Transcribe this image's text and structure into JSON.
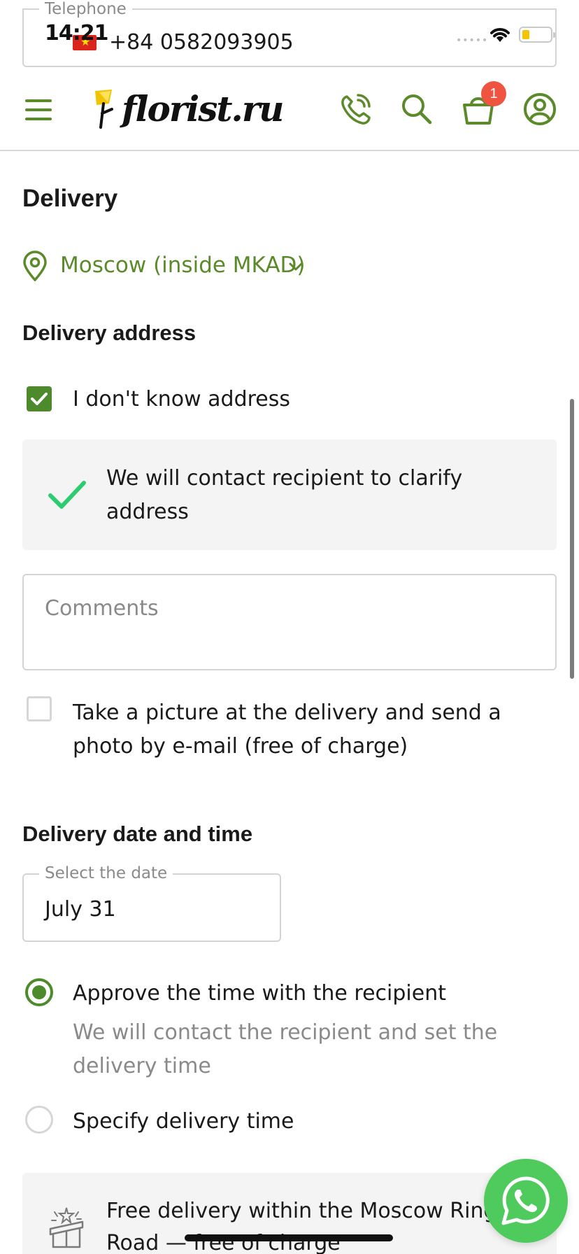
{
  "status_bar": {
    "time": "14:21",
    "signal_dots": "•••••"
  },
  "phone_field": {
    "label": "Telephone",
    "value": "+84 0582093905",
    "flag_icon": "vietnam-flag-icon"
  },
  "header": {
    "logo_text": "florist.ru",
    "cart_count": "1",
    "icons": [
      "menu-icon",
      "phone-icon",
      "search-icon",
      "cart-icon",
      "user-icon"
    ]
  },
  "delivery": {
    "title": "Delivery",
    "city": "Moscow (inside MKAD)",
    "address_title": "Delivery address",
    "unknown_address_label": "I don't know address",
    "unknown_address_checked": true,
    "info_text": "We will contact recipient to clarify address",
    "comments_placeholder": "Comments",
    "photo_label": "Take a picture at the delivery and send a photo by e-mail (free of charge)",
    "photo_checked": false
  },
  "date_time": {
    "title": "Delivery date and time",
    "date_label": "Select the date",
    "date_value": "July 31",
    "option_approve": "Approve the time with the recipient",
    "option_approve_sub": "We will contact the recipient and set the delivery time",
    "option_specify": "Specify delivery time",
    "selected": "approve"
  },
  "promo": {
    "text": "Free delivery within the Moscow Ring Road — free of charge"
  },
  "colors": {
    "brand_green": "#4c8a2b",
    "link_green": "#5a8a2a",
    "badge_red": "#ef5440",
    "whatsapp_green": "#4ecb5c"
  }
}
